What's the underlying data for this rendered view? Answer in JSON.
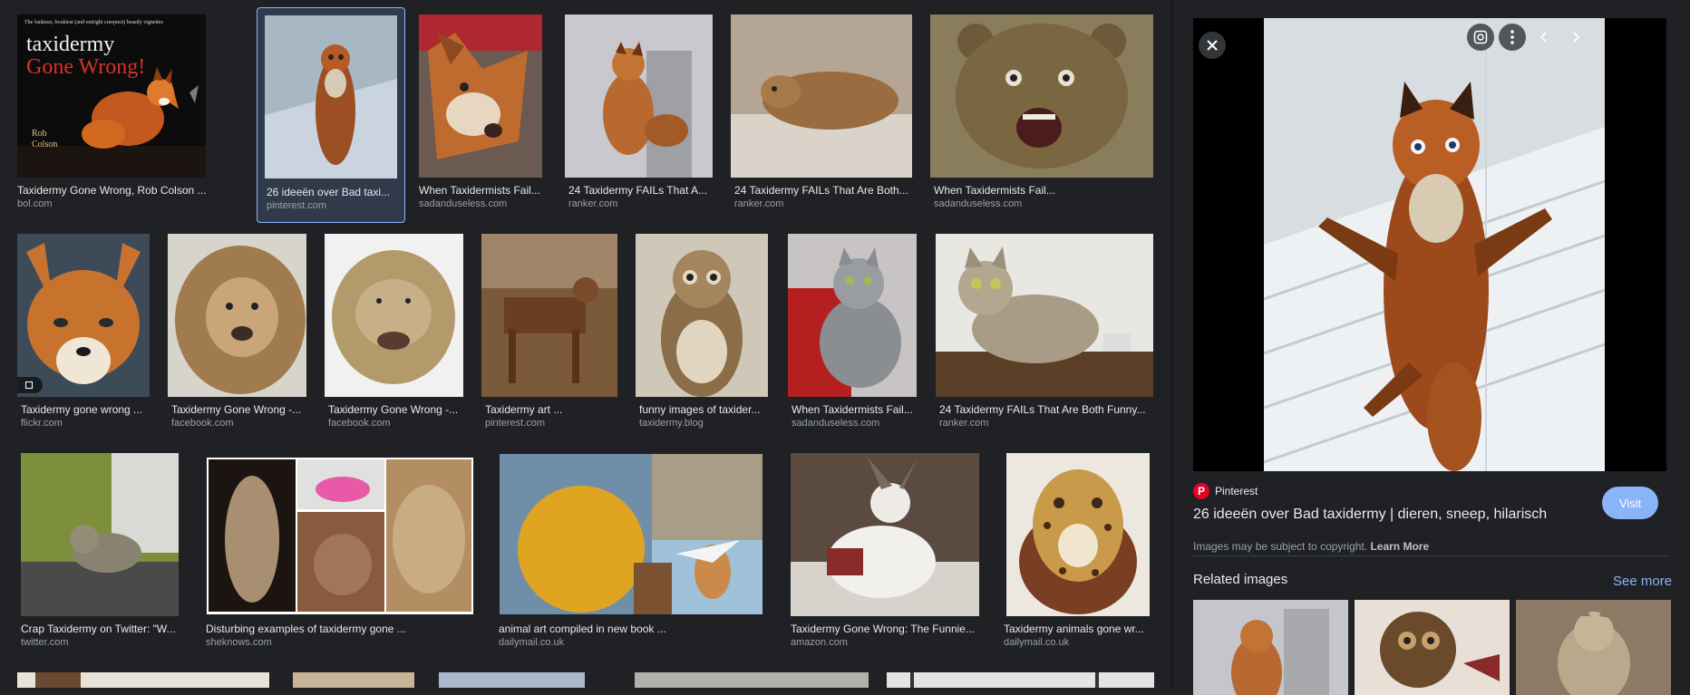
{
  "results": {
    "row1": [
      {
        "caption": "Taxidermy Gone Wrong, Rob Colson ...",
        "source": "bol.com",
        "cover_tagline": "The funkiest, freakiest (and outright creepiest) beastly vignettes",
        "cover_title_1": "taxidermy",
        "cover_title_2": "Gone Wrong!",
        "cover_author_1": "Rob",
        "cover_author_2": "Colson"
      },
      {
        "caption": "26 ideeën over Bad taxi...",
        "source": "pinterest.com"
      },
      {
        "caption": "When Taxidermists Fail...",
        "source": "sadanduseless.com"
      },
      {
        "caption": "24 Taxidermy FAILs That A...",
        "source": "ranker.com"
      },
      {
        "caption": "24 Taxidermy FAILs That Are Both...",
        "source": "ranker.com"
      },
      {
        "caption": "When Taxidermists Fail...",
        "source": "sadanduseless.com"
      }
    ],
    "row2": [
      {
        "caption": "Taxidermy gone wrong ...",
        "source": "flickr.com"
      },
      {
        "caption": "Taxidermy Gone Wrong -...",
        "source": "facebook.com"
      },
      {
        "caption": "Taxidermy Gone Wrong -...",
        "source": "facebook.com"
      },
      {
        "caption": "Taxidermy art ...",
        "source": "pinterest.com"
      },
      {
        "caption": "funny images of taxider...",
        "source": "taxidermy.blog"
      },
      {
        "caption": "When Taxidermists Fail...",
        "source": "sadanduseless.com"
      },
      {
        "caption": "24 Taxidermy FAILs That Are Both Funny...",
        "source": "ranker.com"
      }
    ],
    "row3": [
      {
        "caption": "Crap Taxidermy on Twitter: \"W...",
        "source": "twitter.com"
      },
      {
        "caption": "Disturbing examples of taxidermy gone ...",
        "source": "sheknows.com"
      },
      {
        "caption": "animal art compiled in new book ...",
        "source": "dailymail.co.uk"
      },
      {
        "caption": "Taxidermy Gone Wrong: The Funnie...",
        "source": "amazon.com"
      },
      {
        "caption": "Taxidermy animals gone wr...",
        "source": "dailymail.co.uk"
      }
    ]
  },
  "panel": {
    "site_icon": "P",
    "site_name": "Pinterest",
    "title": "26 ideeën over Bad taxidermy | dieren, sneep, hilarisch",
    "visit_label": "Visit",
    "copyright": "Images may be subject to copyright.",
    "learn_more": "Learn More",
    "related_label": "Related images",
    "see_more": "See more",
    "controls": {
      "close": "close-icon",
      "lens": "lens-icon",
      "more": "more-vert-icon",
      "prev": "chevron-left-icon",
      "next": "chevron-right-icon"
    }
  },
  "colors": {
    "background": "#202124",
    "accent": "#8ab4f8",
    "selected_tile": "#303a4b",
    "pinterest": "#e60023",
    "muted_text": "#9aa0a6"
  }
}
